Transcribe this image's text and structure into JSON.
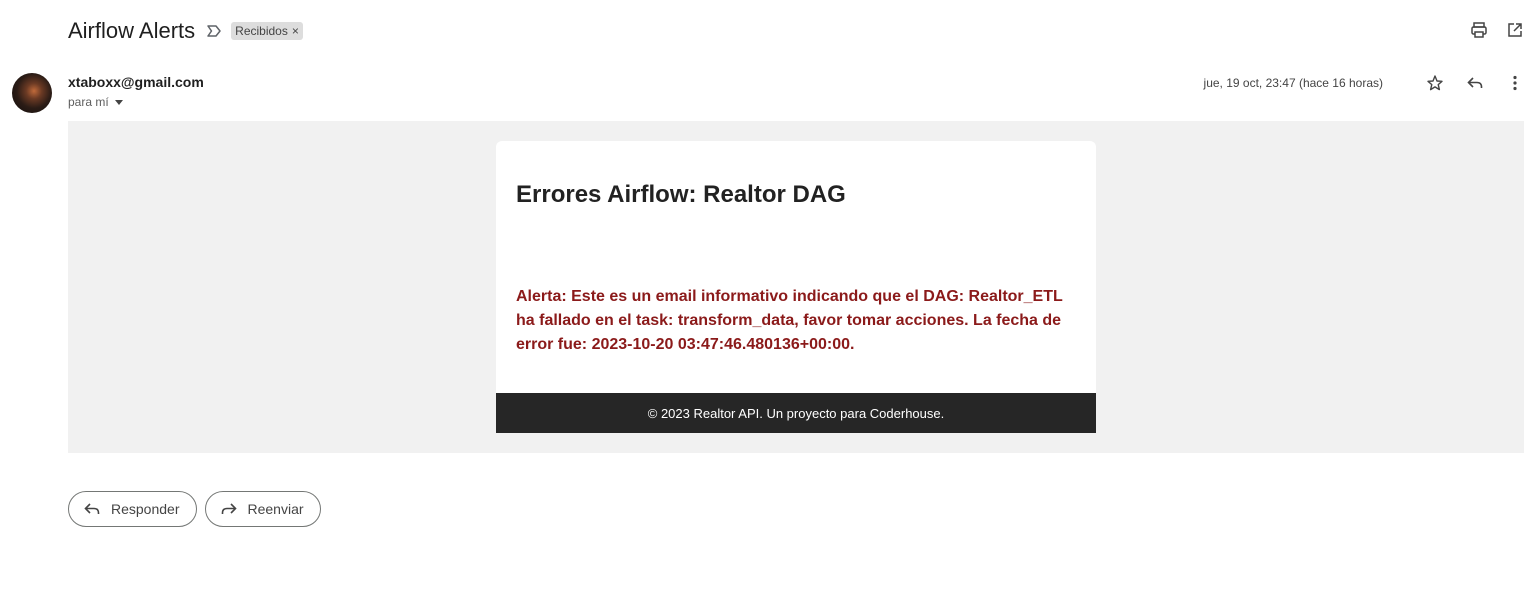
{
  "header": {
    "subject": "Airflow Alerts",
    "label": "Recibidos",
    "label_close": "×"
  },
  "top_actions": {
    "icons": [
      "print-icon",
      "open-in-new-window-icon"
    ]
  },
  "sender": {
    "email": "xtaboxx@gmail.com",
    "recipient": "para mí",
    "date": "jue, 19 oct, 23:47 (hace 16 horas)"
  },
  "message": {
    "title": "Errores Airflow: Realtor DAG",
    "alert": "Alerta: Este es un email informativo indicando que el DAG: Realtor_ETL ha fallado en el task: transform_data, favor tomar acciones. La fecha de error fue: 2023-10-20 03:47:46.480136+00:00.",
    "footer": "© 2023 Realtor API. Un proyecto para Coderhouse."
  },
  "actions": {
    "reply": "Responder",
    "forward": "Reenviar"
  },
  "colors": {
    "alert_text": "#8b1a1a",
    "footer_bg": "#262626",
    "body_bg": "#f1f1f1"
  }
}
